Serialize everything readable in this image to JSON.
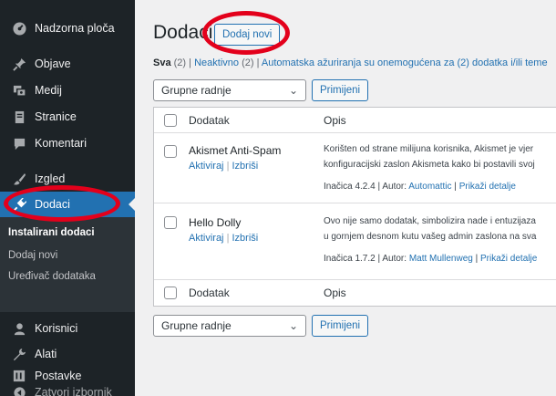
{
  "sidebar": {
    "items": [
      {
        "label": "Nadzorna ploča",
        "icon": "dashboard-icon"
      },
      {
        "label": "Objave",
        "icon": "pin-icon"
      },
      {
        "label": "Medij",
        "icon": "media-icon"
      },
      {
        "label": "Stranice",
        "icon": "page-icon"
      },
      {
        "label": "Komentari",
        "icon": "comment-icon"
      },
      {
        "label": "Izgled",
        "icon": "brush-icon"
      },
      {
        "label": "Dodaci",
        "icon": "plugin-icon"
      },
      {
        "label": "Korisnici",
        "icon": "users-icon"
      },
      {
        "label": "Alati",
        "icon": "wrench-icon"
      },
      {
        "label": "Postavke",
        "icon": "settings-icon"
      },
      {
        "label": "Zatvori izbornik",
        "icon": "collapse-icon"
      }
    ],
    "submenu": [
      "Instalirani dodaci",
      "Dodaj novi",
      "Uređivač dodataka"
    ]
  },
  "header": {
    "title": "Dodaci",
    "add_new": "Dodaj novi"
  },
  "filters": {
    "all": "Sva",
    "all_count": "(2)",
    "inactive": "Neaktivno",
    "inactive_count": "(2)",
    "autoupdates": "Automatska ažuriranja su onemogućena za (2) dodatka i/ili teme",
    "sep": "|"
  },
  "bulk": {
    "select_value": "Grupne radnje",
    "apply": "Primijeni"
  },
  "table": {
    "headers": [
      "Dodatak",
      "Opis"
    ],
    "footers": [
      "Dodatak",
      "Opis"
    ],
    "rows": [
      {
        "name": "Akismet Anti-Spam",
        "activate": "Aktiviraj",
        "delete": "Izbriši",
        "desc1": "Korišten od strane milijuna korisnika, Akismet je vjer",
        "desc2": "konfiguracijski zaslon Akismeta kako bi postavili svoj",
        "version": "Inačica 4.2.4",
        "author_label": "Autor:",
        "author": "Automattic",
        "details": "Prikaži detalje"
      },
      {
        "name": "Hello Dolly",
        "activate": "Aktiviraj",
        "delete": "Izbriši",
        "desc1": "Ovo nije samo dodatak, simbolizira nade i entuzijaza",
        "desc2": "u gornjem desnom kutu vašeg admin zaslona na sva",
        "version": "Inačica 1.7.2",
        "author_label": "Autor:",
        "author": "Matt Mullenweg",
        "details": "Prikaži detalje"
      }
    ]
  },
  "colors": {
    "sidebar": "#1d2327",
    "accent": "#2271b1",
    "highlight": "#e3001b"
  }
}
